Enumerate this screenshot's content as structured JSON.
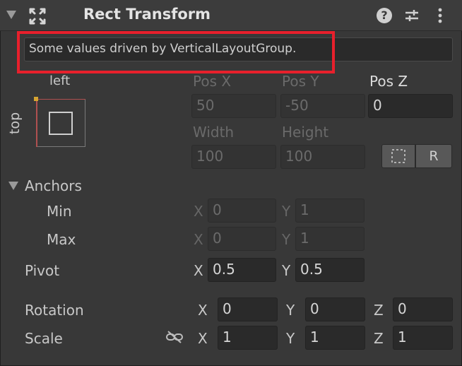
{
  "component": {
    "title": "Rect Transform",
    "icons": [
      "fold-triangle-icon",
      "rect-transform-icon",
      "help-icon",
      "presets-icon",
      "kebab-menu-icon"
    ]
  },
  "banner": {
    "text": "Some values driven by VerticalLayoutGroup."
  },
  "anchor_preset": {
    "horizontal_label": "left",
    "vertical_label": "top"
  },
  "position": {
    "pos_x_label": "Pos X",
    "pos_x": "50",
    "pos_y_label": "Pos Y",
    "pos_y": "-50",
    "pos_z_label": "Pos Z",
    "pos_z": "0",
    "width_label": "Width",
    "width": "100",
    "height_label": "Height",
    "height": "100",
    "raw_button_label": "R"
  },
  "anchors": {
    "label": "Anchors",
    "min_label": "Min",
    "min_x": "0",
    "min_y": "1",
    "max_label": "Max",
    "max_x": "0",
    "max_y": "1"
  },
  "pivot": {
    "label": "Pivot",
    "x": "0.5",
    "y": "0.5"
  },
  "rotation": {
    "label": "Rotation",
    "x": "0",
    "y": "0",
    "z": "0"
  },
  "scale": {
    "label": "Scale",
    "x": "1",
    "y": "1",
    "z": "1"
  },
  "axes": {
    "x": "X",
    "y": "Y",
    "z": "Z"
  },
  "colors": {
    "highlight": "#e8202c",
    "anchor_dot": "#d6a531",
    "anchor_edge": "#b05050"
  }
}
